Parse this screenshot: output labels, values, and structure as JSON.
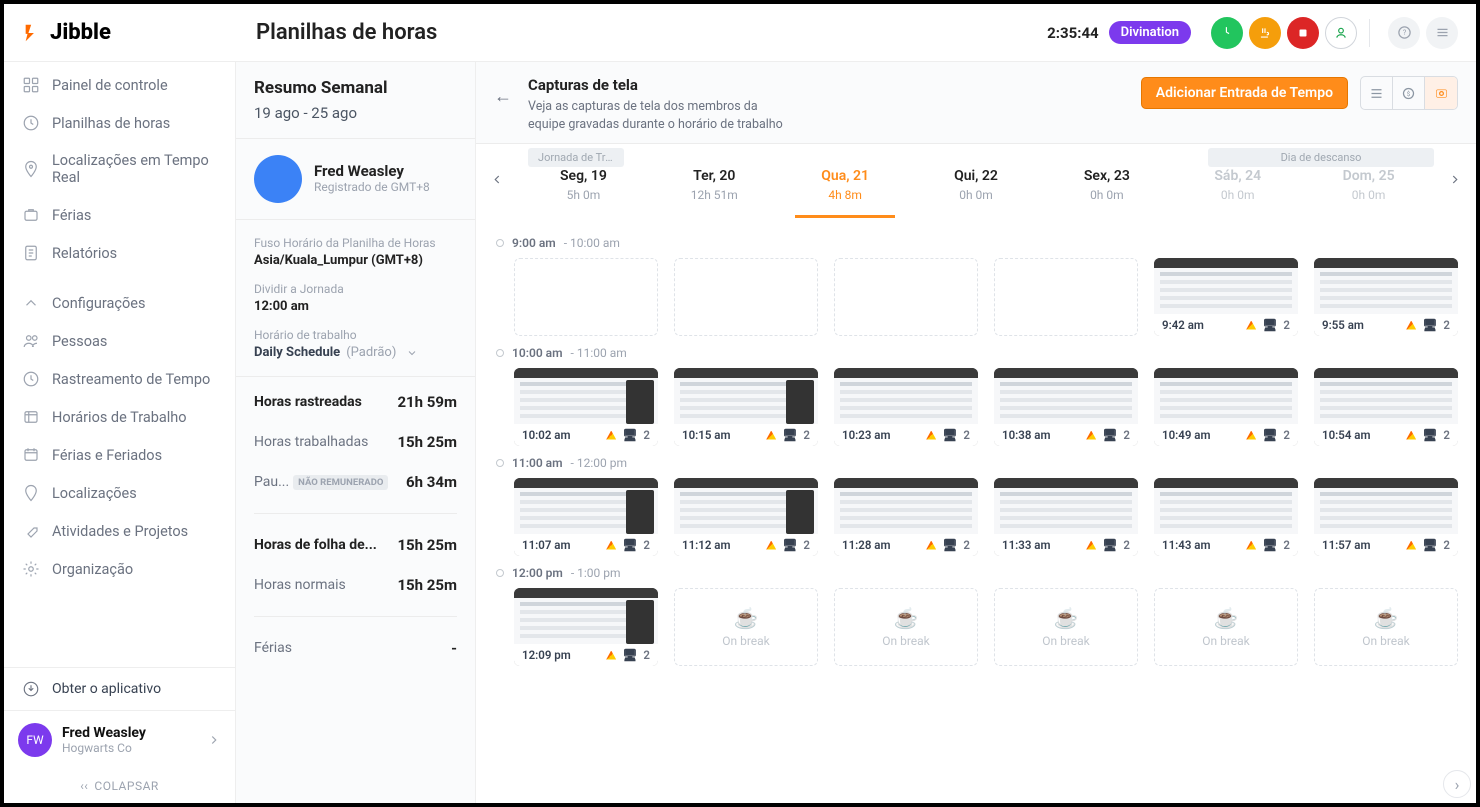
{
  "header": {
    "logo": "Jibble",
    "page_title": "Planilhas de horas",
    "timer": "2:35:44",
    "activity_pill": "Divination"
  },
  "sidebar": {
    "nav1": [
      "Painel de controle",
      "Planilhas de horas",
      "Localizações em Tempo Real",
      "Férias",
      "Relatórios"
    ],
    "nav2": [
      "Configurações",
      "Pessoas",
      "Rastreamento de Tempo",
      "Horários de Trabalho",
      "Férias e Feriados",
      "Localizações",
      "Atividades e Projetos",
      "Organização"
    ],
    "get_app": "Obter o aplicativo",
    "user_name": "Fred Weasley",
    "user_org": "Hogwarts Co",
    "collapse": "COLAPSAR"
  },
  "detail": {
    "summary_title": "Resumo Semanal",
    "date_range": "19 ago - 25 ago",
    "profile_name": "Fred Weasley",
    "profile_sub": "Registrado de GMT+8",
    "tz_label": "Fuso Horário da Planilha de Horas",
    "tz_value": "Asia/Kuala_Lumpur (GMT+8)",
    "split_label": "Dividir a Jornada",
    "split_value": "12:00 am",
    "sched_label": "Horário de trabalho",
    "sched_value": "Daily Schedule",
    "sched_default": "(Padrão)",
    "stats": {
      "tracked_k": "Horas rastreadas",
      "tracked_v": "21h 59m",
      "worked_k": "Horas trabalhadas",
      "worked_v": "15h 25m",
      "break_k": "Pau...",
      "break_badge": "NÃO REMUNERADO",
      "break_v": "6h 34m",
      "payroll_k": "Horas de folha de...",
      "payroll_v": "15h 25m",
      "regular_k": "Horas normais",
      "regular_v": "15h 25m",
      "vac_k": "Férias",
      "vac_v": "-"
    }
  },
  "content_header": {
    "title": "Capturas de tela",
    "subtitle": "Veja as capturas de tela dos membros da equipe gravadas durante o horário de trabalho",
    "add_btn": "Adicionar Entrada de Tempo"
  },
  "days_meta": {
    "work_pill": "Jornada de Trabal...",
    "rest_pill": "Dia de descanso"
  },
  "days": [
    {
      "label": "Seg, 19",
      "hours": "5h 0m"
    },
    {
      "label": "Ter, 20",
      "hours": "12h 51m"
    },
    {
      "label": "Qua, 21",
      "hours": "4h 8m",
      "active": true
    },
    {
      "label": "Qui, 22",
      "hours": "0h 0m"
    },
    {
      "label": "Sex, 23",
      "hours": "0h 0m"
    },
    {
      "label": "Sáb, 24",
      "hours": "0h 0m",
      "muted": true
    },
    {
      "label": "Dom, 25",
      "hours": "0h 0m",
      "muted": true
    }
  ],
  "hours": [
    {
      "start": "9:00 am",
      "end": "10:00 am",
      "shots": [
        null,
        null,
        null,
        null,
        {
          "time": "9:42 am",
          "count": 2
        },
        {
          "time": "9:55 am",
          "count": 2
        }
      ]
    },
    {
      "start": "10:00 am",
      "end": "11:00 am",
      "shots": [
        {
          "time": "10:02 am",
          "count": 2,
          "call": true
        },
        {
          "time": "10:15 am",
          "count": 2,
          "call": true
        },
        {
          "time": "10:23 am",
          "count": 2
        },
        {
          "time": "10:38 am",
          "count": 2
        },
        {
          "time": "10:49 am",
          "count": 2
        },
        {
          "time": "10:54 am",
          "count": 2,
          "dark": true
        }
      ]
    },
    {
      "start": "11:00 am",
      "end": "12:00 pm",
      "shots": [
        {
          "time": "11:07 am",
          "count": 2,
          "call": true
        },
        {
          "time": "11:12 am",
          "count": 2,
          "call": true
        },
        {
          "time": "11:28 am",
          "count": 2
        },
        {
          "time": "11:33 am",
          "count": 2
        },
        {
          "time": "11:43 am",
          "count": 2
        },
        {
          "time": "11:57 am",
          "count": 2
        }
      ]
    },
    {
      "start": "12:00 pm",
      "end": "1:00 pm",
      "shots": [
        {
          "time": "12:09 pm",
          "count": 2,
          "call": true
        },
        {
          "break": true
        },
        {
          "break": true
        },
        {
          "break": true
        },
        {
          "break": true
        },
        {
          "break": true
        }
      ]
    }
  ],
  "break_label": "On break"
}
